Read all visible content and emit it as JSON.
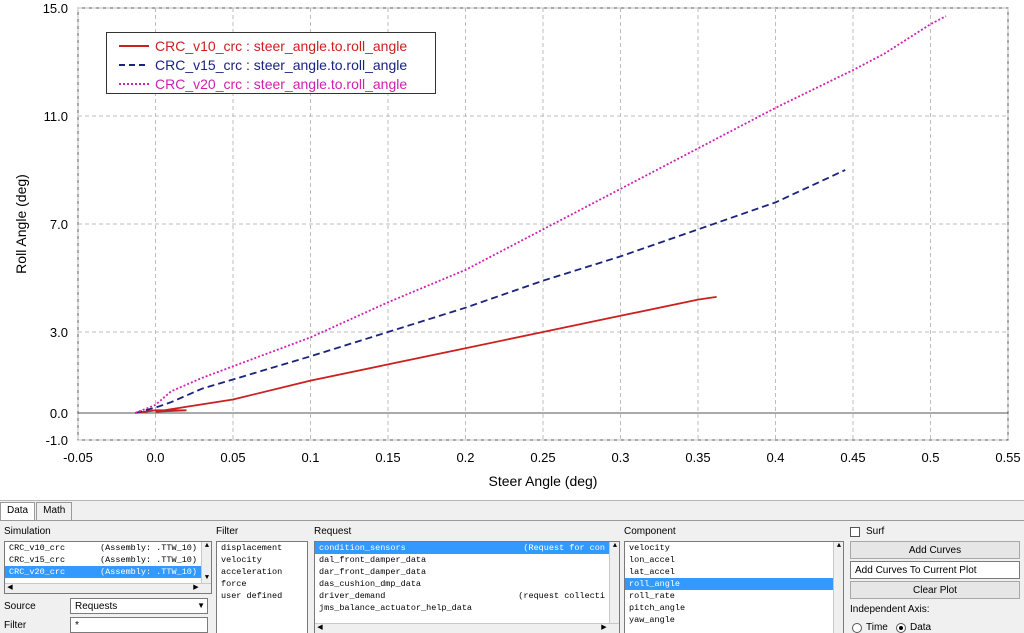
{
  "chart_data": {
    "type": "line",
    "xlabel": "Steer Angle (deg)",
    "ylabel": "Roll Angle (deg)",
    "xlim": [
      -0.05,
      0.55
    ],
    "ylim": [
      -1.0,
      15.0
    ],
    "x_ticks": [
      "-0.05",
      "0.0",
      "0.05",
      "0.1",
      "0.15",
      "0.2",
      "0.25",
      "0.3",
      "0.35",
      "0.4",
      "0.45",
      "0.5",
      "0.55"
    ],
    "y_ticks": [
      "-1.0",
      "0.0",
      "3.0",
      "7.0",
      "11.0",
      "15.0"
    ],
    "grid": true,
    "legend_position": "top-left",
    "series": [
      {
        "name": "CRC_v10_crc : steer_angle.to.roll_angle",
        "color": "#cc2020",
        "dash": "solid",
        "points": [
          [
            -0.013,
            0.0
          ],
          [
            0.0,
            0.1
          ],
          [
            0.02,
            0.1
          ],
          [
            0.0,
            0.05
          ],
          [
            0.05,
            0.5
          ],
          [
            0.1,
            1.2
          ],
          [
            0.15,
            1.8
          ],
          [
            0.2,
            2.4
          ],
          [
            0.25,
            3.0
          ],
          [
            0.3,
            3.6
          ],
          [
            0.35,
            4.2
          ],
          [
            0.362,
            4.3
          ]
        ]
      },
      {
        "name": "CRC_v15_crc : steer_angle.to.roll_angle",
        "color": "#1a237e",
        "dash": "dashed",
        "points": [
          [
            -0.013,
            0.0
          ],
          [
            0.0,
            0.2
          ],
          [
            0.01,
            0.4
          ],
          [
            0.03,
            0.9
          ],
          [
            0.1,
            2.1
          ],
          [
            0.15,
            3.0
          ],
          [
            0.2,
            3.9
          ],
          [
            0.25,
            4.9
          ],
          [
            0.3,
            5.8
          ],
          [
            0.35,
            6.8
          ],
          [
            0.4,
            7.8
          ],
          [
            0.43,
            8.6
          ],
          [
            0.445,
            9.0
          ]
        ]
      },
      {
        "name": "CRC_v20_crc : steer_angle.to.roll_angle",
        "color": "#d020b0",
        "dash": "dotted",
        "points": [
          [
            -0.013,
            0.0
          ],
          [
            0.0,
            0.3
          ],
          [
            0.01,
            0.8
          ],
          [
            0.03,
            1.3
          ],
          [
            0.1,
            2.8
          ],
          [
            0.15,
            4.1
          ],
          [
            0.2,
            5.3
          ],
          [
            0.25,
            6.8
          ],
          [
            0.3,
            8.3
          ],
          [
            0.35,
            9.8
          ],
          [
            0.4,
            11.3
          ],
          [
            0.45,
            12.7
          ],
          [
            0.47,
            13.3
          ],
          [
            0.5,
            14.4
          ],
          [
            0.51,
            14.7
          ]
        ]
      }
    ]
  },
  "panel": {
    "tabs": [
      "Data",
      "Math"
    ],
    "simulation_label": "Simulation",
    "simulations": [
      {
        "name": "CRC_v10_crc",
        "detail": "(Assembly: .TTW_10)",
        "selected": false
      },
      {
        "name": "CRC_v15_crc",
        "detail": "(Assembly: .TTW_10)",
        "selected": false
      },
      {
        "name": "CRC_v20_crc",
        "detail": "(Assembly: .TTW_10)",
        "selected": true
      }
    ],
    "source_label": "Source",
    "source_value": "Requests",
    "filter_field_label": "Filter",
    "filter_field_value": "*",
    "filter_label": "Filter",
    "filters": [
      "displacement",
      "velocity",
      "acceleration",
      "force",
      "user defined"
    ],
    "request_label": "Request",
    "requests": [
      {
        "name": "condition_sensors",
        "detail": "(Request for con",
        "selected": true
      },
      {
        "name": "dal_front_damper_data",
        "detail": "",
        "selected": false
      },
      {
        "name": "dar_front_damper_data",
        "detail": "",
        "selected": false
      },
      {
        "name": "das_cushion_dmp_data",
        "detail": "",
        "selected": false
      },
      {
        "name": "driver_demand",
        "detail": "(request collecti",
        "selected": false
      },
      {
        "name": "jms_balance_actuator_help_data",
        "detail": "",
        "selected": false
      }
    ],
    "component_label": "Component",
    "components": [
      {
        "name": "velocity",
        "selected": false
      },
      {
        "name": "lon_accel",
        "selected": false
      },
      {
        "name": "lat_accel",
        "selected": false
      },
      {
        "name": "roll_angle",
        "selected": true
      },
      {
        "name": "roll_rate",
        "selected": false
      },
      {
        "name": "pitch_angle",
        "selected": false
      },
      {
        "name": "yaw_angle",
        "selected": false
      }
    ],
    "surf_label": "Surf",
    "add_curves_label": "Add Curves",
    "add_mode_value": "Add Curves To Current Plot",
    "clear_plot_label": "Clear Plot",
    "independent_axis_label": "Independent Axis:",
    "radio_time_label": "Time",
    "radio_data_label": "Data"
  }
}
